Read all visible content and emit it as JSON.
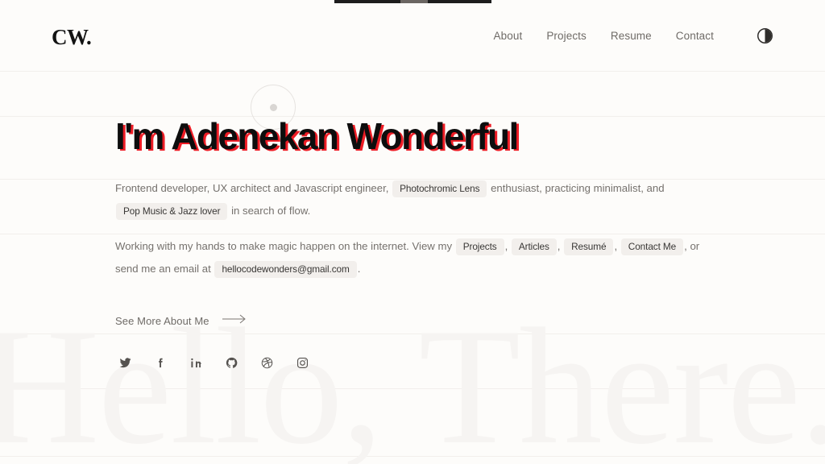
{
  "theme": {
    "background": "#fdfcfa",
    "accent_red": "#ee1c25",
    "text_dark": "#0d0d0d",
    "text_muted": "#75716d",
    "chip_bg": "#f2efec",
    "watermark_color": "#f6f4f2"
  },
  "header": {
    "logo": "CW.",
    "nav": [
      {
        "label": "About"
      },
      {
        "label": "Projects"
      },
      {
        "label": "Resume"
      },
      {
        "label": "Contact"
      }
    ],
    "theme_toggle_icon": "contrast-half-circle-icon"
  },
  "hero": {
    "title": "I'm Adenekan Wonderful",
    "paragraph_1": {
      "part_1": "Frontend developer, UX architect and Javascript engineer,",
      "chip_1": "Photochromic Lens",
      "part_2": "enthusiast, practicing minimalist, and",
      "chip_2": "Pop Music & Jazz lover",
      "part_3": "in search of flow."
    },
    "paragraph_2": {
      "part_1": "Working with my hands to make magic happen on the internet. View my",
      "chip_projects": "Projects",
      "comma_1": ",",
      "chip_articles": "Articles",
      "comma_2": ",",
      "chip_resume": "Resumé",
      "comma_3": ",",
      "chip_contact": "Contact Me",
      "part_2": ", or send me",
      "part_3": "an email at",
      "chip_email": "hellocodewonders@gmail.com",
      "period": "."
    }
  },
  "cta": {
    "label": "See More About Me",
    "icon": "arrow-right-icon"
  },
  "social": [
    {
      "name": "twitter"
    },
    {
      "name": "facebook"
    },
    {
      "name": "linkedin"
    },
    {
      "name": "github"
    },
    {
      "name": "dribbble"
    },
    {
      "name": "instagram"
    }
  ],
  "watermark": {
    "text": "Hello, There."
  },
  "decoration": {
    "circle": "outlined-circle-with-dot"
  }
}
